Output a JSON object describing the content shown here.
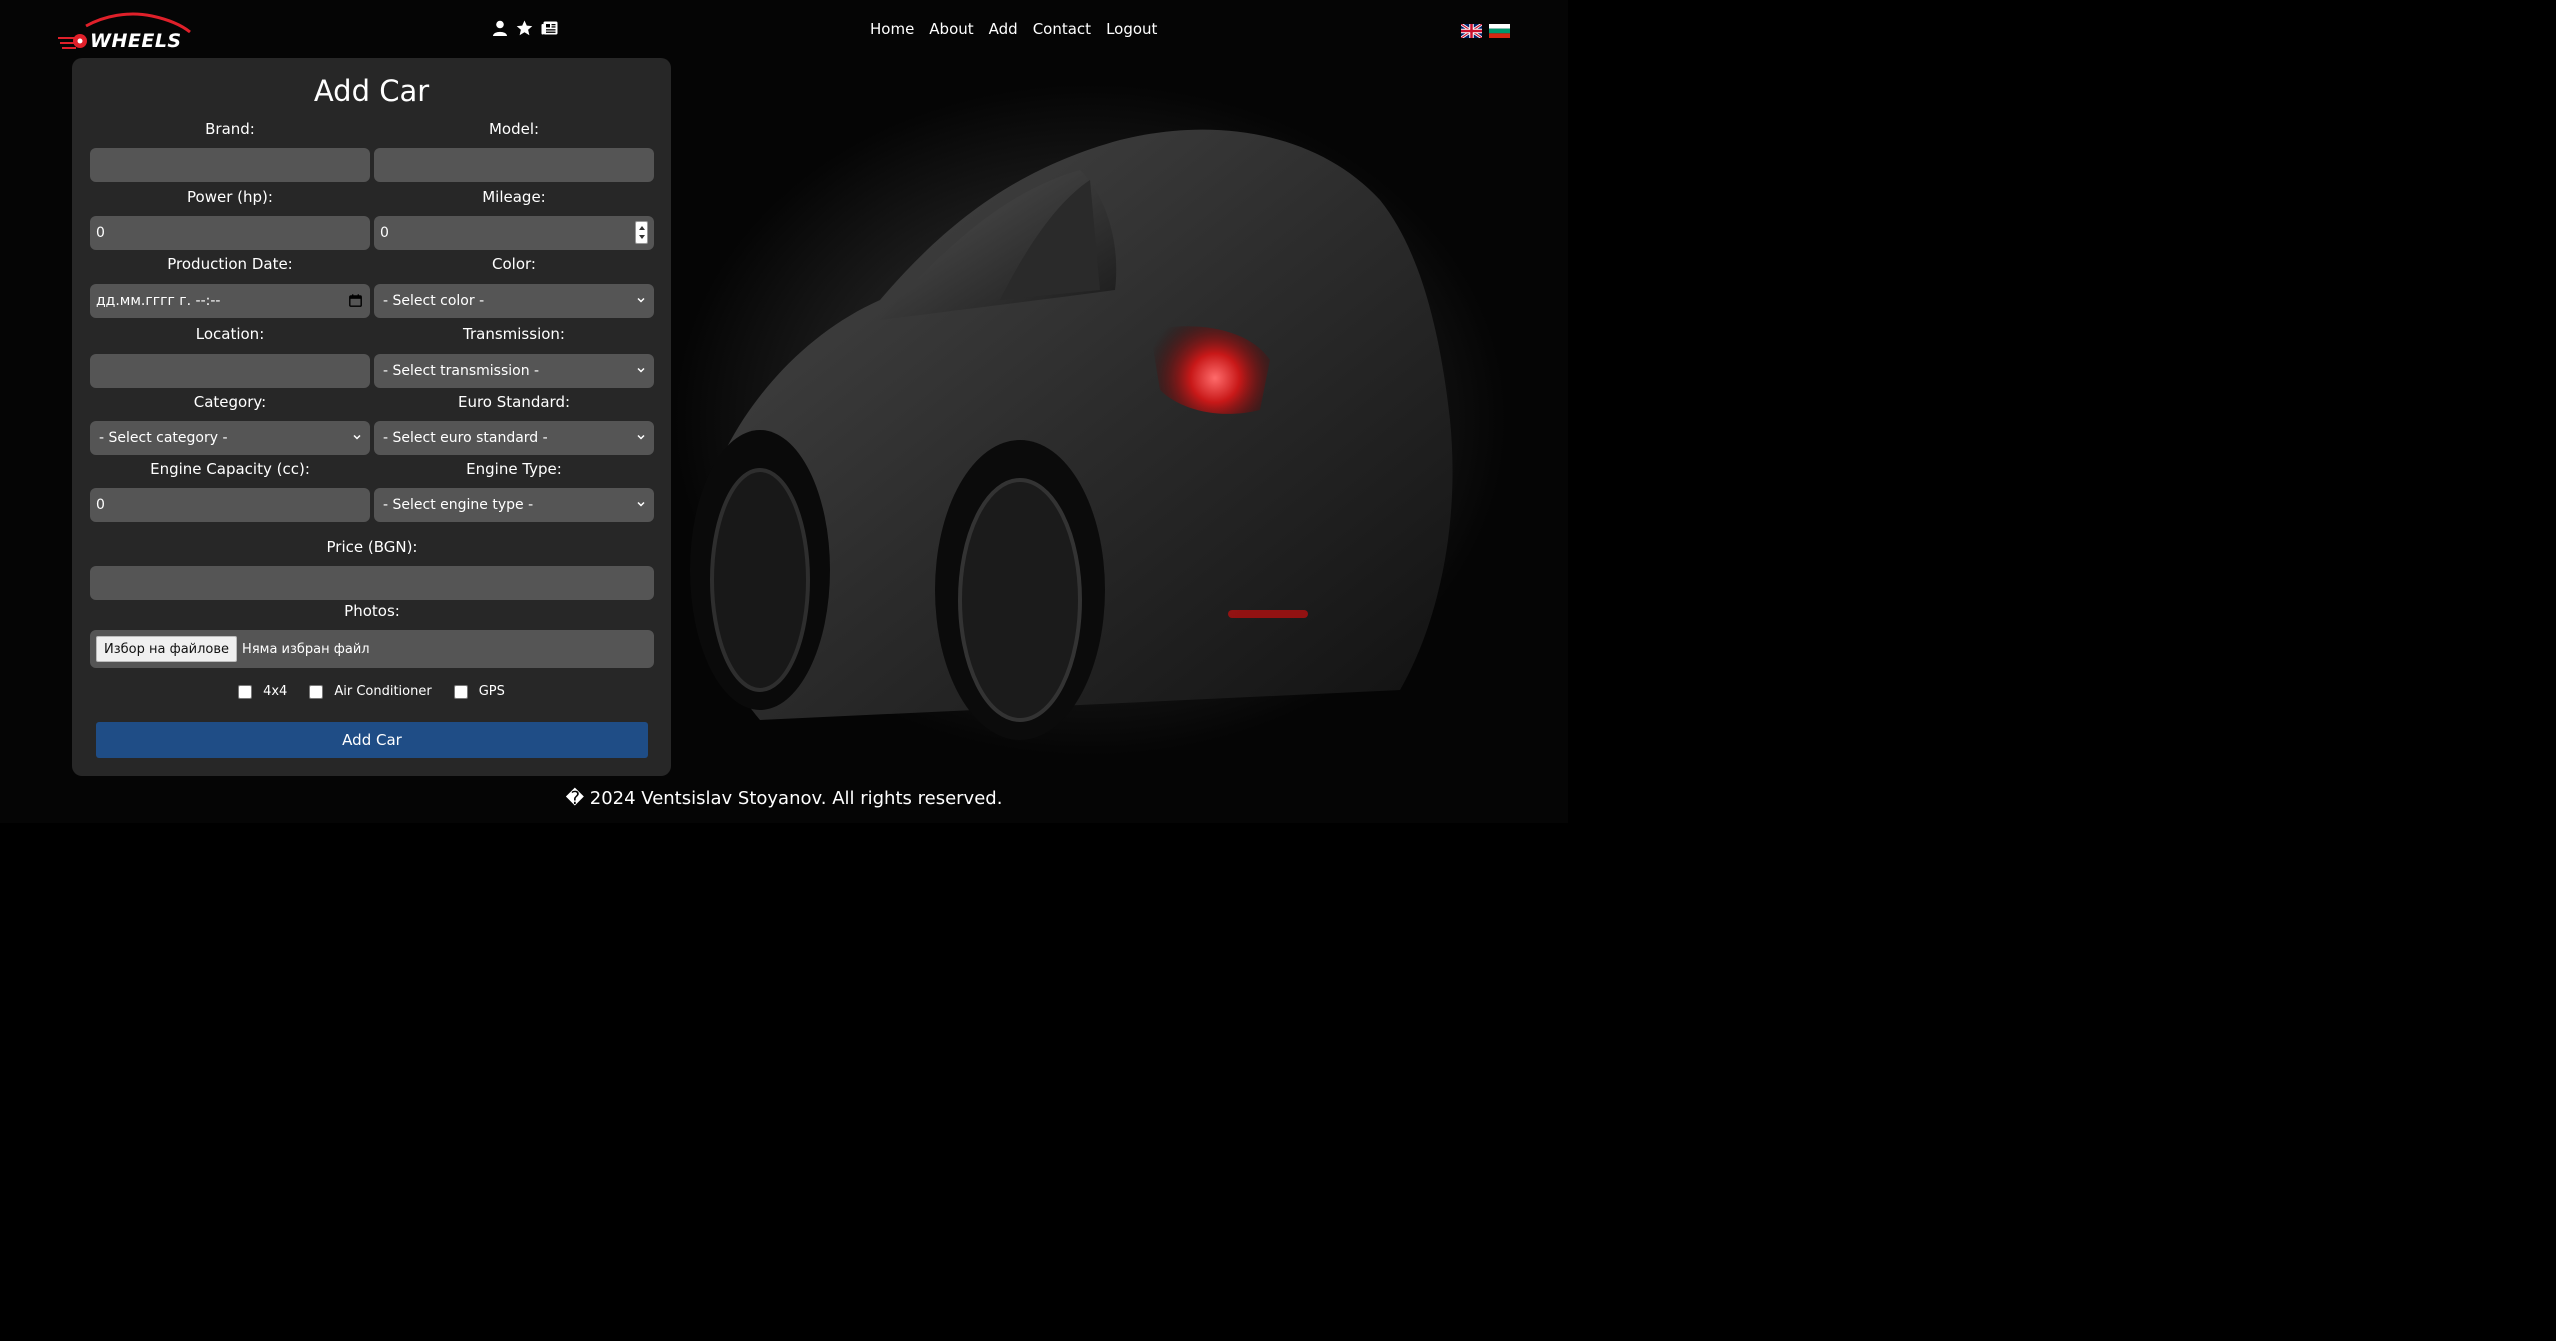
{
  "brand": {
    "logo_text": "WHEELS"
  },
  "header": {
    "icons": [
      "user-icon",
      "star-icon",
      "newspaper-icon"
    ],
    "nav": [
      "Home",
      "About",
      "Add",
      "Contact",
      "Logout"
    ],
    "languages": [
      "en",
      "bg"
    ]
  },
  "form": {
    "title": "Add Car",
    "brand_label": "Brand:",
    "brand_value": "",
    "model_label": "Model:",
    "model_value": "",
    "power_label": "Power (hp):",
    "power_value": "0",
    "mileage_label": "Mileage:",
    "mileage_value": "0",
    "production_date_label": "Production Date:",
    "production_date_value": "дд.мм.гггг г. --:--",
    "color_label": "Color:",
    "color_value": "- Select color -",
    "location_label": "Location:",
    "location_value": "",
    "transmission_label": "Transmission:",
    "transmission_value": "- Select transmission -",
    "category_label": "Category:",
    "category_value": "- Select category -",
    "euro_label": "Euro Standard:",
    "euro_value": "- Select euro standard -",
    "engine_capacity_label": "Engine Capacity (cc):",
    "engine_capacity_value": "0",
    "engine_type_label": "Engine Type:",
    "engine_type_value": "- Select engine type -",
    "price_label": "Price (BGN):",
    "price_value": "",
    "photos_label": "Photos:",
    "file_button": "Избор на файлове",
    "file_status": "Няма избран файл",
    "checkboxes": [
      {
        "label": "4x4",
        "checked": false
      },
      {
        "label": "Air Conditioner",
        "checked": false
      },
      {
        "label": "GPS",
        "checked": false
      }
    ],
    "submit": "Add Car"
  },
  "footer": {
    "text": "� 2024 Ventsislav Stoyanov. All rights reserved."
  },
  "colors": {
    "panel": "#282828",
    "field": "#555555",
    "submit": "#1f4d86",
    "logo_red": "#e0202a",
    "tail_light": "#c81818"
  }
}
